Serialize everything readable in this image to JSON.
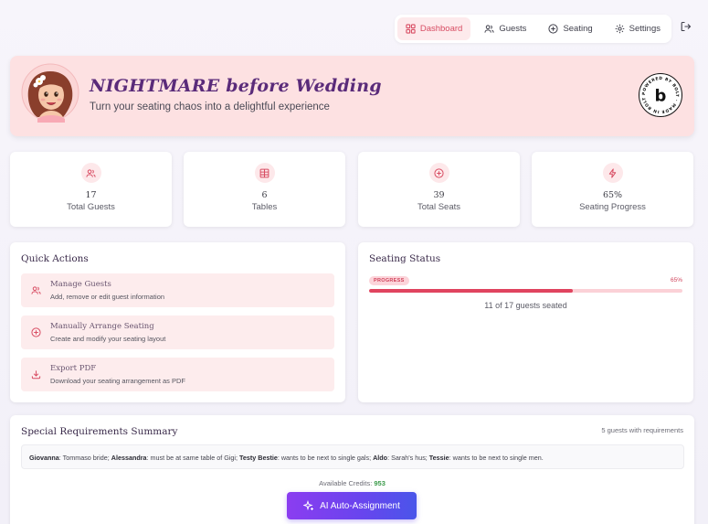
{
  "nav": {
    "items": [
      {
        "label": "Dashboard",
        "icon": "grid-icon",
        "active": true
      },
      {
        "label": "Guests",
        "icon": "users-icon",
        "active": false
      },
      {
        "label": "Seating",
        "icon": "plus-circle-icon",
        "active": false
      },
      {
        "label": "Settings",
        "icon": "gear-icon",
        "active": false
      }
    ],
    "logout_icon": "logout-icon"
  },
  "hero": {
    "title": "NIGHTMARE before Wedding",
    "subtitle": "Turn your seating chaos into a delightful experience",
    "badge_text": "POWERED BY BOLT · MADE IN BOLT · NEW",
    "badge_letter": "b"
  },
  "stats": [
    {
      "value": "17",
      "label": "Total Guests",
      "icon": "users-icon"
    },
    {
      "value": "6",
      "label": "Tables",
      "icon": "table-icon"
    },
    {
      "value": "39",
      "label": "Total Seats",
      "icon": "plus-circle-icon"
    },
    {
      "value": "65%",
      "label": "Seating Progress",
      "icon": "lightning-icon"
    }
  ],
  "quick_actions": {
    "title": "Quick Actions",
    "items": [
      {
        "title": "Manage Guests",
        "desc": "Add, remove or edit guest information",
        "icon": "users-icon"
      },
      {
        "title": "Manually Arrange Seating",
        "desc": "Create and modify your seating layout",
        "icon": "plus-circle-icon"
      },
      {
        "title": "Export PDF",
        "desc": "Download your seating arrangement as PDF",
        "icon": "download-icon"
      }
    ]
  },
  "seating_status": {
    "title": "Seating Status",
    "pill": "PROGRESS",
    "percent_label": "65%",
    "progress": 0.65,
    "seated_text": "11 of 17 guests seated"
  },
  "requirements": {
    "title": "Special Requirements Summary",
    "count_text": "5 guests with requirements",
    "entries": [
      {
        "name": "Giovanna",
        "text": ": Tommaso bride; "
      },
      {
        "name": "Alessandra",
        "text": ": must be at same table of Gigi; "
      },
      {
        "name": "Testy Bestie",
        "text": ": wants to be next to single gals; "
      },
      {
        "name": "Aldo",
        "text": ": Sarah's hus; "
      },
      {
        "name": "Tessie",
        "text": ": wants to be next to single men."
      }
    ],
    "credits_label": "Available Credits: ",
    "credits_value": "953",
    "ai_button": "AI Auto-Assignment"
  },
  "colors": {
    "accent": "#d84d63",
    "hero_bg": "#fde1e2",
    "title_purple": "#5a2b7a",
    "button_start": "#8b3df0",
    "button_end": "#4a55ea"
  }
}
